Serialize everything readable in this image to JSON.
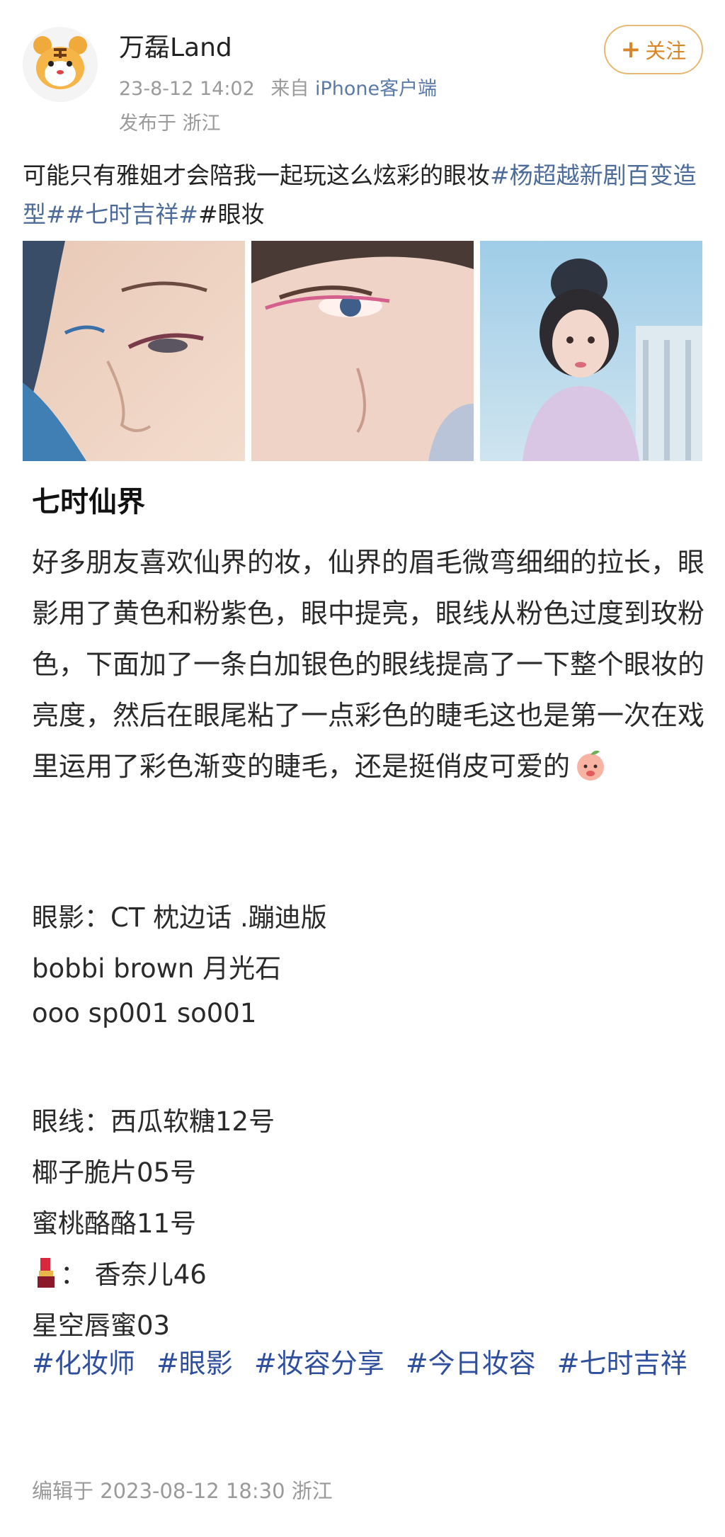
{
  "post": {
    "username": "万磊Land",
    "timestamp": "23-8-12 14:02",
    "via_prefix": "来自",
    "via_source": "iPhone客户端",
    "location": "发布于 浙江",
    "follow_label": "关注",
    "follow_icon": "plus-icon",
    "text_intro": "可能只有雅姐才会陪我一起玩这么炫彩的眼妆",
    "topics": [
      "#杨超越新剧百变造型#",
      "#七时吉祥#",
      "#眼妆"
    ],
    "image_count": 3
  },
  "section": {
    "title": "七时仙界",
    "paragraph": "好多朋友喜欢仙界的妆，仙界的眉毛微弯细细的拉长，眼影用了黄色和粉紫色，眼中提亮，眼线从粉色过度到玫粉色，下面加了一条白加银色的眼线提高了一下整个眼妆的亮度，然后在眼尾粘了一点彩色的睫毛这也是第一次在戏里运用了彩色渐变的睫毛，还是挺俏皮可爱的",
    "paragraph_emoji": "peach-face-icon",
    "eyeshadow_label": "眼影：",
    "eyeshadow_items": [
      "CT 枕边话 .蹦迪版",
      "bobbi brown 月光石",
      "ooo sp001  so001"
    ],
    "eyeliner_label": "眼线：",
    "eyeliner_items": [
      "西瓜软糖12号",
      "椰子脆片05号",
      "蜜桃酪酪11号"
    ],
    "lipstick_icon": "lipstick-icon",
    "lipstick_text": "： 香奈儿46",
    "lip_gloss": "星空唇蜜03",
    "hashtags": [
      "#化妆师",
      "#眼影",
      "#妆容分享",
      "#今日妆容",
      "#七时吉祥"
    ],
    "edited": "编辑于 2023-08-12 18:30 浙江"
  },
  "colors": {
    "link": "#4d6c99",
    "hashtag": "#2e4f9e",
    "follow": "#d8862a",
    "meta": "#9a9a9a"
  }
}
